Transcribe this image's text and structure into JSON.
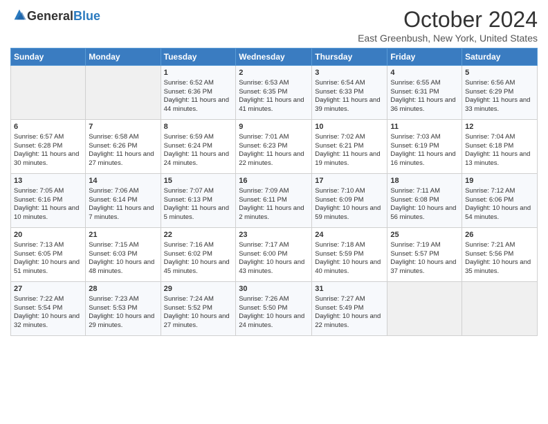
{
  "logo": {
    "general": "General",
    "blue": "Blue"
  },
  "header": {
    "month": "October 2024",
    "location": "East Greenbush, New York, United States"
  },
  "days_of_week": [
    "Sunday",
    "Monday",
    "Tuesday",
    "Wednesday",
    "Thursday",
    "Friday",
    "Saturday"
  ],
  "weeks": [
    [
      {
        "day": "",
        "info": ""
      },
      {
        "day": "",
        "info": ""
      },
      {
        "day": "1",
        "info": "Sunrise: 6:52 AM\nSunset: 6:36 PM\nDaylight: 11 hours and 44 minutes."
      },
      {
        "day": "2",
        "info": "Sunrise: 6:53 AM\nSunset: 6:35 PM\nDaylight: 11 hours and 41 minutes."
      },
      {
        "day": "3",
        "info": "Sunrise: 6:54 AM\nSunset: 6:33 PM\nDaylight: 11 hours and 39 minutes."
      },
      {
        "day": "4",
        "info": "Sunrise: 6:55 AM\nSunset: 6:31 PM\nDaylight: 11 hours and 36 minutes."
      },
      {
        "day": "5",
        "info": "Sunrise: 6:56 AM\nSunset: 6:29 PM\nDaylight: 11 hours and 33 minutes."
      }
    ],
    [
      {
        "day": "6",
        "info": "Sunrise: 6:57 AM\nSunset: 6:28 PM\nDaylight: 11 hours and 30 minutes."
      },
      {
        "day": "7",
        "info": "Sunrise: 6:58 AM\nSunset: 6:26 PM\nDaylight: 11 hours and 27 minutes."
      },
      {
        "day": "8",
        "info": "Sunrise: 6:59 AM\nSunset: 6:24 PM\nDaylight: 11 hours and 24 minutes."
      },
      {
        "day": "9",
        "info": "Sunrise: 7:01 AM\nSunset: 6:23 PM\nDaylight: 11 hours and 22 minutes."
      },
      {
        "day": "10",
        "info": "Sunrise: 7:02 AM\nSunset: 6:21 PM\nDaylight: 11 hours and 19 minutes."
      },
      {
        "day": "11",
        "info": "Sunrise: 7:03 AM\nSunset: 6:19 PM\nDaylight: 11 hours and 16 minutes."
      },
      {
        "day": "12",
        "info": "Sunrise: 7:04 AM\nSunset: 6:18 PM\nDaylight: 11 hours and 13 minutes."
      }
    ],
    [
      {
        "day": "13",
        "info": "Sunrise: 7:05 AM\nSunset: 6:16 PM\nDaylight: 11 hours and 10 minutes."
      },
      {
        "day": "14",
        "info": "Sunrise: 7:06 AM\nSunset: 6:14 PM\nDaylight: 11 hours and 7 minutes."
      },
      {
        "day": "15",
        "info": "Sunrise: 7:07 AM\nSunset: 6:13 PM\nDaylight: 11 hours and 5 minutes."
      },
      {
        "day": "16",
        "info": "Sunrise: 7:09 AM\nSunset: 6:11 PM\nDaylight: 11 hours and 2 minutes."
      },
      {
        "day": "17",
        "info": "Sunrise: 7:10 AM\nSunset: 6:09 PM\nDaylight: 10 hours and 59 minutes."
      },
      {
        "day": "18",
        "info": "Sunrise: 7:11 AM\nSunset: 6:08 PM\nDaylight: 10 hours and 56 minutes."
      },
      {
        "day": "19",
        "info": "Sunrise: 7:12 AM\nSunset: 6:06 PM\nDaylight: 10 hours and 54 minutes."
      }
    ],
    [
      {
        "day": "20",
        "info": "Sunrise: 7:13 AM\nSunset: 6:05 PM\nDaylight: 10 hours and 51 minutes."
      },
      {
        "day": "21",
        "info": "Sunrise: 7:15 AM\nSunset: 6:03 PM\nDaylight: 10 hours and 48 minutes."
      },
      {
        "day": "22",
        "info": "Sunrise: 7:16 AM\nSunset: 6:02 PM\nDaylight: 10 hours and 45 minutes."
      },
      {
        "day": "23",
        "info": "Sunrise: 7:17 AM\nSunset: 6:00 PM\nDaylight: 10 hours and 43 minutes."
      },
      {
        "day": "24",
        "info": "Sunrise: 7:18 AM\nSunset: 5:59 PM\nDaylight: 10 hours and 40 minutes."
      },
      {
        "day": "25",
        "info": "Sunrise: 7:19 AM\nSunset: 5:57 PM\nDaylight: 10 hours and 37 minutes."
      },
      {
        "day": "26",
        "info": "Sunrise: 7:21 AM\nSunset: 5:56 PM\nDaylight: 10 hours and 35 minutes."
      }
    ],
    [
      {
        "day": "27",
        "info": "Sunrise: 7:22 AM\nSunset: 5:54 PM\nDaylight: 10 hours and 32 minutes."
      },
      {
        "day": "28",
        "info": "Sunrise: 7:23 AM\nSunset: 5:53 PM\nDaylight: 10 hours and 29 minutes."
      },
      {
        "day": "29",
        "info": "Sunrise: 7:24 AM\nSunset: 5:52 PM\nDaylight: 10 hours and 27 minutes."
      },
      {
        "day": "30",
        "info": "Sunrise: 7:26 AM\nSunset: 5:50 PM\nDaylight: 10 hours and 24 minutes."
      },
      {
        "day": "31",
        "info": "Sunrise: 7:27 AM\nSunset: 5:49 PM\nDaylight: 10 hours and 22 minutes."
      },
      {
        "day": "",
        "info": ""
      },
      {
        "day": "",
        "info": ""
      }
    ]
  ]
}
